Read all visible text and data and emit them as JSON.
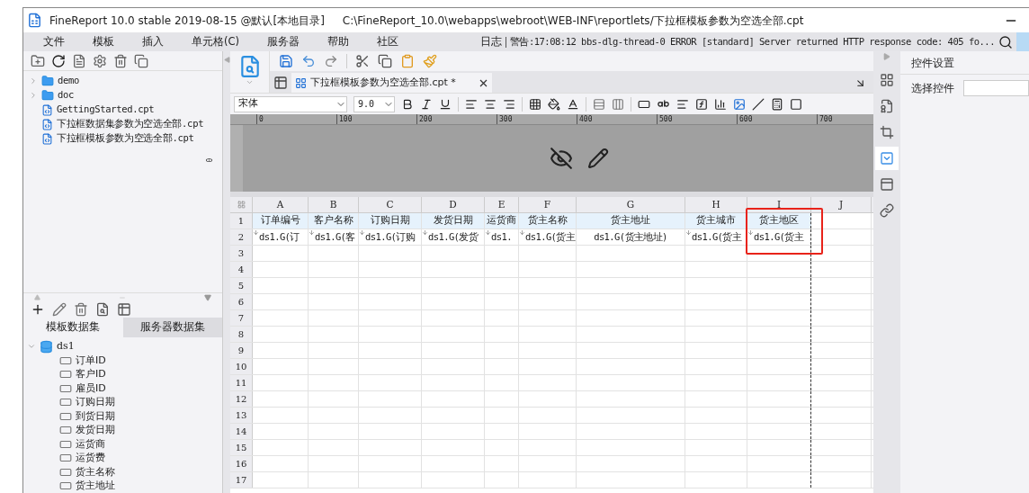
{
  "window": {
    "title": "FineReport 10.0 stable 2019-08-15 @默认[本地目录]",
    "path": "C:\\FineReport_10.0\\webapps\\webroot\\WEB-INF\\reportlets/下拉框模板参数为空选全部.cpt"
  },
  "menu": {
    "items": [
      "文件",
      "模板",
      "插入",
      "单元格(C)",
      "服务器",
      "帮助",
      "社区"
    ],
    "log_label": "日志",
    "log_message": "警告:17:08:12 bbs-dlg-thread-0 ERROR [standard] Server returned HTTP response code: 405 fo..."
  },
  "file_tree": [
    {
      "kind": "folder",
      "label": "demo",
      "expanded": false
    },
    {
      "kind": "folder",
      "label": "doc",
      "expanded": false
    },
    {
      "kind": "file",
      "label": "GettingStarted.cpt"
    },
    {
      "kind": "file",
      "label": "下拉框数据集参数为空选全部.cpt"
    },
    {
      "kind": "file",
      "label": "下拉框模板参数为空选全部.cpt"
    }
  ],
  "dataset_tabs": [
    {
      "label": "模板数据集",
      "selected": true
    },
    {
      "label": "服务器数据集",
      "selected": false
    }
  ],
  "dataset_tree": [
    {
      "label": "ds1",
      "expanded": true,
      "children": [
        {
          "label": "订单ID"
        },
        {
          "label": "客户ID"
        },
        {
          "label": "雇员ID"
        },
        {
          "label": "订购日期"
        },
        {
          "label": "到货日期"
        },
        {
          "label": "发货日期"
        },
        {
          "label": "运货商"
        },
        {
          "label": "运货费"
        },
        {
          "label": "货主名称"
        },
        {
          "label": "货主地址"
        }
      ]
    }
  ],
  "editor": {
    "tab_label": "下拉框模板参数为空选全部.cpt *",
    "font": "宋体",
    "font_size": "9.0",
    "ruler_labels": [
      "0",
      "100",
      "200",
      "300",
      "400",
      "500",
      "600",
      "700"
    ],
    "vertical_ruler_label": "0"
  },
  "grid": {
    "columns": [
      "A",
      "B",
      "C",
      "D",
      "E",
      "F",
      "G",
      "H",
      "I",
      "J"
    ],
    "rows": [
      {
        "label": "1",
        "kind": "header",
        "cells": [
          "订单编号",
          "客户名称",
          "订购日期",
          "发货日期",
          "运货商",
          "货主名称",
          "货主地址",
          "货主城市",
          "货主地区"
        ]
      },
      {
        "label": "2",
        "kind": "data",
        "cells": [
          "ds1.G(订",
          "ds1.G(客",
          "ds1.G(订购",
          "ds1.G(发货",
          "ds1.",
          "ds1.G(货主",
          "ds1.G(货主地址)",
          "ds1.G(货主",
          "ds1.G(货主"
        ]
      },
      {
        "label": "3"
      },
      {
        "label": "4"
      },
      {
        "label": "5"
      },
      {
        "label": "6"
      },
      {
        "label": "7"
      },
      {
        "label": "8"
      },
      {
        "label": "9"
      },
      {
        "label": "10"
      },
      {
        "label": "11"
      },
      {
        "label": "12"
      },
      {
        "label": "13"
      },
      {
        "label": "14"
      },
      {
        "label": "15"
      },
      {
        "label": "16"
      },
      {
        "label": "17"
      }
    ]
  },
  "right_panel": {
    "title": "控件设置",
    "field_label": "选择控件",
    "side_icons": [
      {
        "kind": "grid",
        "selected": false
      },
      {
        "kind": "info",
        "selected": false
      },
      {
        "kind": "frame",
        "selected": false
      },
      {
        "kind": "widget",
        "selected": true
      },
      {
        "kind": "layout",
        "selected": false
      },
      {
        "kind": "link",
        "selected": false
      }
    ]
  }
}
